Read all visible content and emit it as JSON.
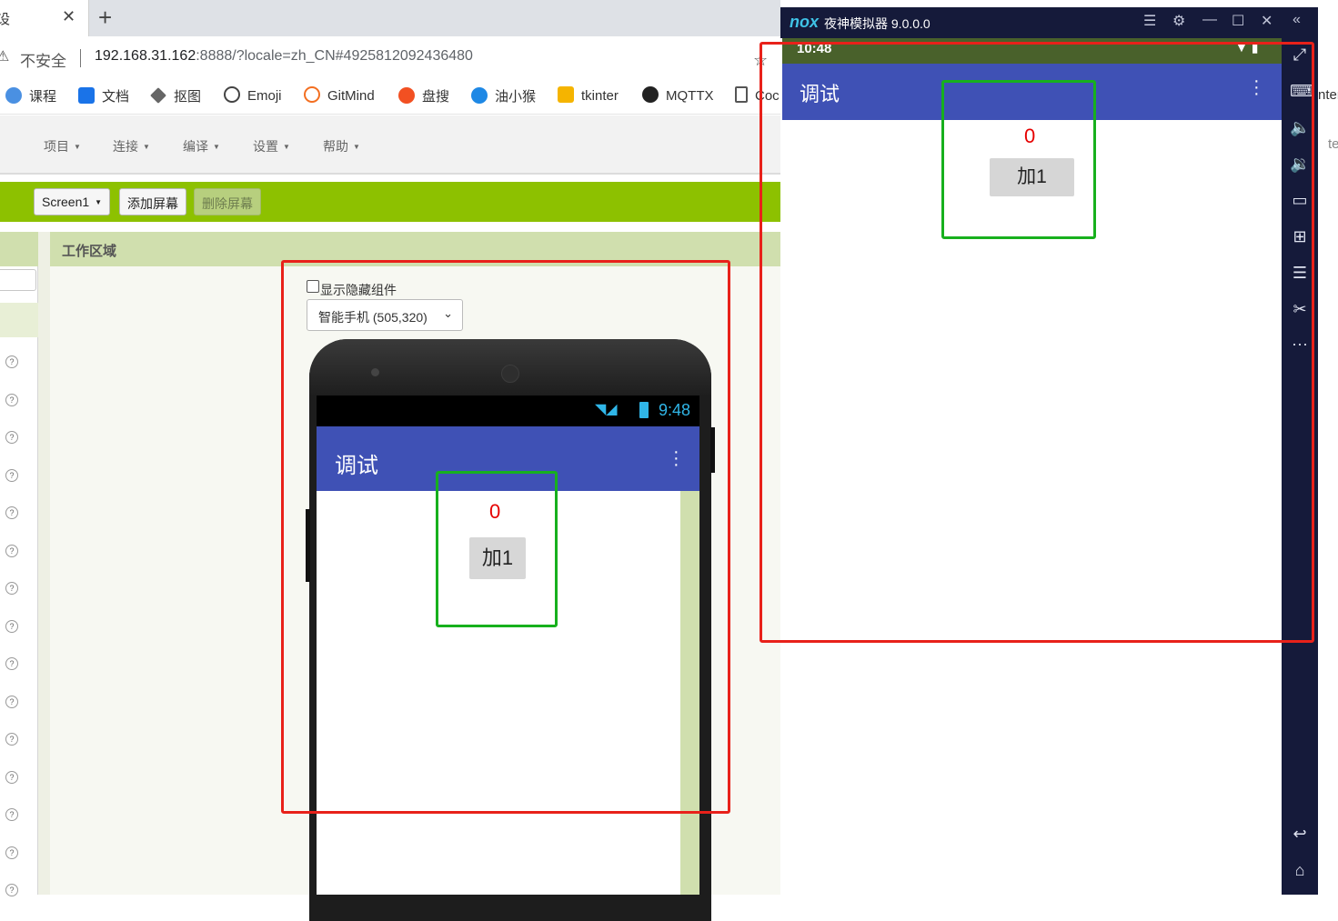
{
  "browser": {
    "tab_title": "设",
    "tab_close": "✕",
    "new_tab": "+",
    "insecure_label": "不安全",
    "url_host": "192.168.31.162",
    "url_rest": ":8888/?locale=zh_CN#4925812092436480",
    "bookmarks": [
      {
        "label": "课程",
        "icon": "course-icon",
        "color": "#1a73e8"
      },
      {
        "label": "文档",
        "icon": "docs-icon",
        "color": "#1a73e8"
      },
      {
        "label": "抠图",
        "icon": "layers-icon",
        "color": "#555555"
      },
      {
        "label": "Emoji",
        "icon": "smiley-icon",
        "color": "#444444"
      },
      {
        "label": "GitMind",
        "icon": "gitmind-icon",
        "color": "#f36f21"
      },
      {
        "label": "盘搜",
        "icon": "pansou-icon",
        "color": "#f25022"
      },
      {
        "label": "油小猴",
        "icon": "monkey-icon",
        "color": "#1e88e5"
      },
      {
        "label": "tkinter",
        "icon": "tkinter-icon",
        "color": "#f5b400"
      },
      {
        "label": "MQTTX",
        "icon": "github-icon",
        "color": "#222222"
      },
      {
        "label": "Coc",
        "icon": "page-icon",
        "color": "#555555"
      }
    ]
  },
  "app": {
    "menus": [
      "项目",
      "连接",
      "编译",
      "设置",
      "帮助"
    ],
    "screen_select": "Screen1",
    "add_screen": "添加屏幕",
    "delete_screen": "删除屏幕",
    "workarea_title": "工作区域",
    "show_hidden_label": "显示隐藏组件",
    "device_select": "智能手机 (505,320)",
    "help_marker": "?"
  },
  "preview_phone": {
    "status_time": "9:48",
    "app_title": "调试",
    "counter_value": "0",
    "button_label": "加1"
  },
  "emulator": {
    "logo": "nox",
    "window_title": "夜神模拟器 9.0.0.0",
    "status_time": "10:48",
    "app_title": "调试",
    "counter_value": "0",
    "button_label": "加1",
    "accent_color": "#3f51b5",
    "counter_color": "#e60000"
  },
  "right_fragment": {
    "text1": "nter",
    "text2": "te"
  }
}
